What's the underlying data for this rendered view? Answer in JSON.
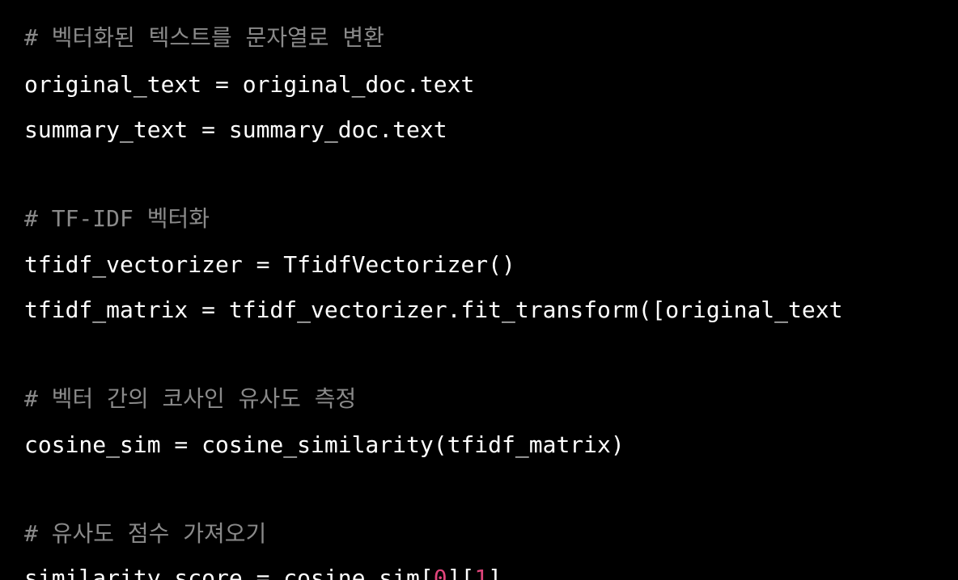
{
  "colors": {
    "background": "#000000",
    "code_text": "#ffffff",
    "comment": "#8a8a8a",
    "number_literal": "#e0457b"
  },
  "code": {
    "line1": "# 벡터화된 텍스트를 문자열로 변환",
    "line2": "original_text = original_doc.text",
    "line3": "summary_text = summary_doc.text",
    "line4": "# TF-IDF 벡터화",
    "line5": "tfidf_vectorizer = TfidfVectorizer()",
    "line6": "tfidf_matrix = tfidf_vectorizer.fit_transform([original_text",
    "line7": "# 벡터 간의 코사인 유사도 측정",
    "line8": "cosine_sim = cosine_similarity(tfidf_matrix)",
    "line9": "# 유사도 점수 가져오기",
    "line10_pre": "similarity_score = cosine_sim[",
    "line10_num1": "0",
    "line10_mid": "][",
    "line10_num2": "1",
    "line10_post": "]"
  }
}
